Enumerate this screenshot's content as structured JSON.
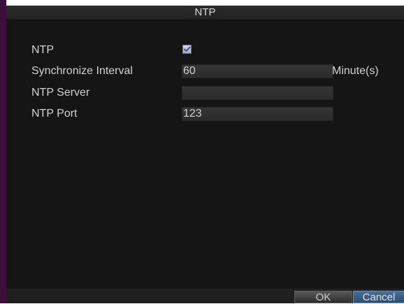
{
  "window": {
    "title": "NTP"
  },
  "form": {
    "ntp_label": "NTP",
    "ntp_enabled": true,
    "sync_interval_label": "Synchronize Interval",
    "sync_interval_value": "60",
    "sync_interval_unit": "Minute(s)",
    "server_label": "NTP Server",
    "server_value": "",
    "port_label": "NTP Port",
    "port_value": "123"
  },
  "buttons": {
    "ok": "OK",
    "cancel": "Cancel"
  },
  "colors": {
    "background": "#151515",
    "field": "#2f2f2f",
    "text": "#d2d2d2",
    "accent": "#2d4c70"
  },
  "icons": {
    "checkbox": "checkmark-icon"
  }
}
